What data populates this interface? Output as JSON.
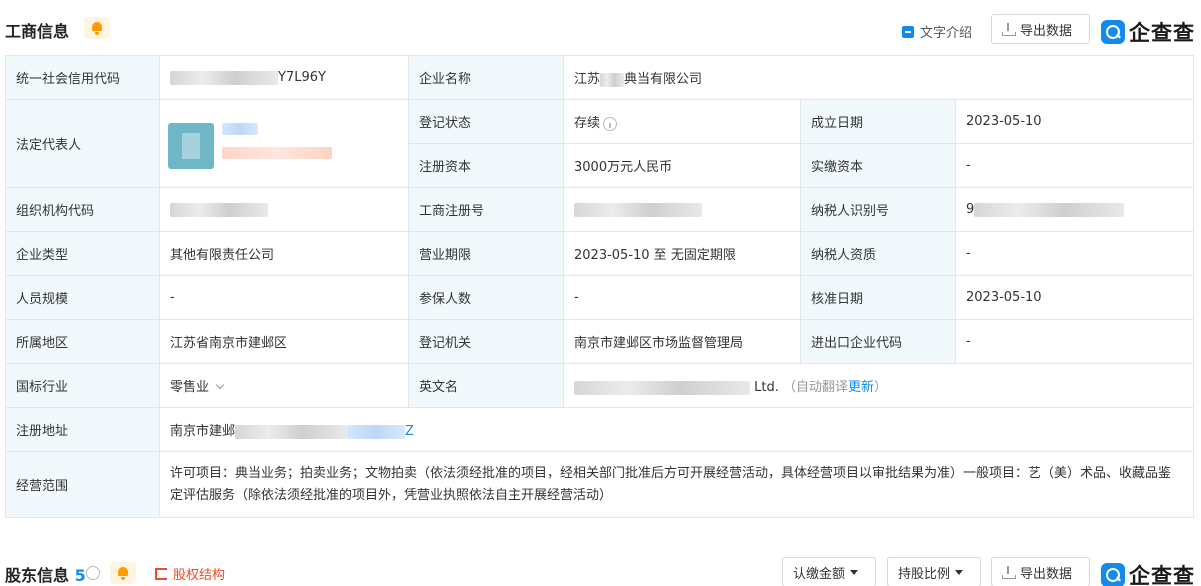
{
  "section1": {
    "title": "工商信息",
    "text_intro": "文字介绍",
    "export": "导出数据",
    "brand": "企查查"
  },
  "table": {
    "credit_code_label": "统一社会信用代码",
    "credit_code_suffix": "Y7L96Y",
    "company_name_label": "企业名称",
    "company_name_prefix": "江苏",
    "company_name_suffix": "典当有限公司",
    "legal_rep_label": "法定代表人",
    "reg_status_label": "登记状态",
    "reg_status": "存续",
    "est_date_label": "成立日期",
    "est_date": "2023-05-10",
    "reg_capital_label": "注册资本",
    "reg_capital": "3000万元人民币",
    "paid_capital_label": "实缴资本",
    "paid_capital": "-",
    "org_code_label": "组织机构代码",
    "biz_reg_no_label": "工商注册号",
    "taxpayer_id_label": "纳税人识别号",
    "taxpayer_id_prefix": "9",
    "company_type_label": "企业类型",
    "company_type": "其他有限责任公司",
    "biz_term_label": "营业期限",
    "biz_term": "2023-05-10 至 无固定期限",
    "taxpayer_qual_label": "纳税人资质",
    "taxpayer_qual": "-",
    "staff_size_label": "人员规模",
    "staff_size": "-",
    "insured_label": "参保人数",
    "insured": "-",
    "approval_date_label": "核准日期",
    "approval_date": "2023-05-10",
    "region_label": "所属地区",
    "region": "江苏省南京市建邺区",
    "reg_authority_label": "登记机关",
    "reg_authority": "南京市建邺区市场监督管理局",
    "import_export_label": "进出口企业代码",
    "import_export": "-",
    "industry_label": "国标行业",
    "industry": "零售业",
    "english_name_label": "英文名",
    "english_name_suffix": "Ltd.",
    "auto_translate": "（自动翻译",
    "update_link": "更新",
    "auto_translate_end": "）",
    "reg_address_label": "注册地址",
    "reg_address_prefix": "南京市建邺",
    "reg_address_end": "Z",
    "biz_scope_label": "经营范围",
    "biz_scope": "许可项目：典当业务；拍卖业务；文物拍卖（依法须经批准的项目，经相关部门批准后方可开展经营活动，具体经营项目以审批结果为准）一般项目：艺（美）术品、收藏品鉴定评估服务（除依法须经批准的项目外，凭营业执照依法自主开展经营活动）"
  },
  "section2": {
    "title": "股东信息",
    "count": "5",
    "equity_structure": "股权结构",
    "subscribed_amount": "认缴金额",
    "holding_ratio": "持股比例",
    "export": "导出数据",
    "brand": "企查查"
  },
  "colors": {
    "accent": "#128bed",
    "label_bg": "#f2f9fc",
    "bell": "#ff9c00",
    "equity": "#f04a26"
  }
}
